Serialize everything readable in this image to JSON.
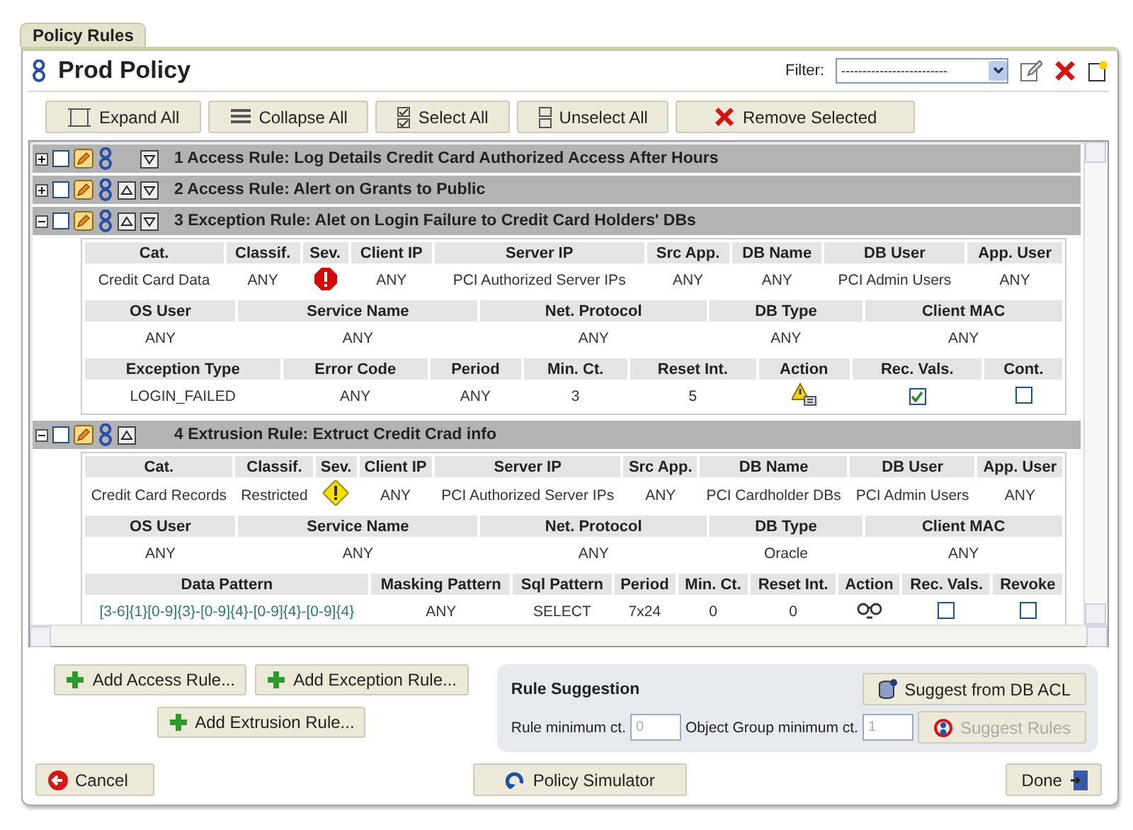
{
  "tab": {
    "label": "Policy Rules",
    "selected": true
  },
  "policy": {
    "title": "Prod Policy"
  },
  "filter": {
    "label": "Filter:",
    "value": "-------------------------"
  },
  "toolbar": [
    {
      "kind": "expand",
      "label": "Expand All"
    },
    {
      "kind": "collapse",
      "label": "Collapse All"
    },
    {
      "kind": "select",
      "label": "Select All"
    },
    {
      "kind": "unselect",
      "label": "Unselect All"
    },
    {
      "kind": "remove",
      "label": "Remove Selected"
    }
  ],
  "rules": [
    {
      "title": "1 Access Rule: Log Details Credit Card Authorized Access After Hours",
      "expanded": false,
      "checked": false,
      "move_up": false,
      "move_down": true
    },
    {
      "title": "2 Access Rule: Alert on Grants to Public",
      "expanded": false,
      "checked": false,
      "move_up": true,
      "move_down": true
    },
    {
      "title": "3 Exception Rule: Alet on Login Failure to Credit Card Holders' DBs",
      "expanded": true,
      "checked": false,
      "move_up": true,
      "move_down": true,
      "sections": [
        {
          "headers": [
            "Cat.",
            "Classif.",
            "Sev.",
            "Client IP",
            "Server IP",
            "Src App.",
            "DB Name",
            "DB User",
            "App. User"
          ],
          "cells": [
            {
              "kind": "text",
              "text": "Credit Card Data"
            },
            {
              "kind": "text",
              "text": "ANY"
            },
            {
              "kind": "sev-high"
            },
            {
              "kind": "text",
              "text": "ANY"
            },
            {
              "kind": "text",
              "text": "PCI Authorized Server IPs"
            },
            {
              "kind": "text",
              "text": "ANY"
            },
            {
              "kind": "text",
              "text": "ANY"
            },
            {
              "kind": "text",
              "text": "PCI Admin Users"
            },
            {
              "kind": "text",
              "text": "ANY"
            }
          ]
        },
        {
          "headers": [
            "OS User",
            "Service Name",
            "Net. Protocol",
            "DB Type",
            "Client MAC"
          ],
          "cells": [
            {
              "kind": "text",
              "text": "ANY"
            },
            {
              "kind": "text",
              "text": "ANY"
            },
            {
              "kind": "text",
              "text": "ANY"
            },
            {
              "kind": "text",
              "text": "ANY"
            },
            {
              "kind": "text",
              "text": "ANY"
            }
          ]
        },
        {
          "headers": [
            "Exception Type",
            "Error Code",
            "Period",
            "Min. Ct.",
            "Reset Int.",
            "Action",
            "Rec. Vals.",
            "Cont."
          ],
          "cells": [
            {
              "kind": "text",
              "text": "LOGIN_FAILED"
            },
            {
              "kind": "text",
              "text": "ANY"
            },
            {
              "kind": "text",
              "text": "ANY"
            },
            {
              "kind": "text",
              "text": "3"
            },
            {
              "kind": "text",
              "text": "5"
            },
            {
              "kind": "action-alert"
            },
            {
              "kind": "checkbox",
              "checked": true
            },
            {
              "kind": "checkbox",
              "checked": false
            }
          ]
        }
      ]
    },
    {
      "title": "4 Extrusion Rule: Extruct Credit Crad info",
      "expanded": true,
      "checked": false,
      "move_up": true,
      "move_down": false,
      "sections": [
        {
          "headers": [
            "Cat.",
            "Classif.",
            "Sev.",
            "Client IP",
            "Server IP",
            "Src App.",
            "DB Name",
            "DB User",
            "App. User"
          ],
          "cells": [
            {
              "kind": "text",
              "text": "Credit Card Records"
            },
            {
              "kind": "text",
              "text": "Restricted"
            },
            {
              "kind": "sev-warning"
            },
            {
              "kind": "text",
              "text": "ANY"
            },
            {
              "kind": "text",
              "text": "PCI Authorized Server IPs"
            },
            {
              "kind": "text",
              "text": "ANY"
            },
            {
              "kind": "text",
              "text": "PCI Cardholder DBs"
            },
            {
              "kind": "text",
              "text": "PCI Admin Users"
            },
            {
              "kind": "text",
              "text": "ANY"
            }
          ]
        },
        {
          "headers": [
            "OS User",
            "Service Name",
            "Net. Protocol",
            "DB Type",
            "Client MAC"
          ],
          "cells": [
            {
              "kind": "text",
              "text": "ANY"
            },
            {
              "kind": "text",
              "text": "ANY"
            },
            {
              "kind": "text",
              "text": "ANY"
            },
            {
              "kind": "text",
              "text": "Oracle"
            },
            {
              "kind": "text",
              "text": "ANY"
            }
          ]
        },
        {
          "headers": [
            "Data Pattern",
            "Masking Pattern",
            "Sql Pattern",
            "Period",
            "Min. Ct.",
            "Reset Int.",
            "Action",
            "Rec. Vals.",
            "Revoke"
          ],
          "cells": [
            {
              "kind": "pattern",
              "text": "[3-6]{1}[0-9]{3}-[0-9]{4}-[0-9]{4}-[0-9]{4}"
            },
            {
              "kind": "text",
              "text": "ANY"
            },
            {
              "kind": "text",
              "text": "SELECT"
            },
            {
              "kind": "text",
              "text": "7x24"
            },
            {
              "kind": "text",
              "text": "0"
            },
            {
              "kind": "text",
              "text": "0"
            },
            {
              "kind": "action-mask"
            },
            {
              "kind": "checkbox",
              "checked": false
            },
            {
              "kind": "checkbox",
              "checked": false
            }
          ]
        }
      ]
    }
  ],
  "add_buttons": [
    {
      "label": "Add Access Rule..."
    },
    {
      "label": "Add Exception Rule..."
    },
    {
      "label": "Add Extrusion Rule..."
    }
  ],
  "suggestion": {
    "title": "Rule Suggestion",
    "acl_button": "Suggest from DB ACL",
    "rule_min_label": "Rule minimum ct.",
    "rule_min_value": "0",
    "group_min_label": "Object Group minimum ct.",
    "group_min_value": "1",
    "suggest_button": {
      "label": "Suggest Rules",
      "disabled": true
    }
  },
  "footer": {
    "cancel": "Cancel",
    "simulator": "Policy Simulator",
    "done": "Done"
  }
}
